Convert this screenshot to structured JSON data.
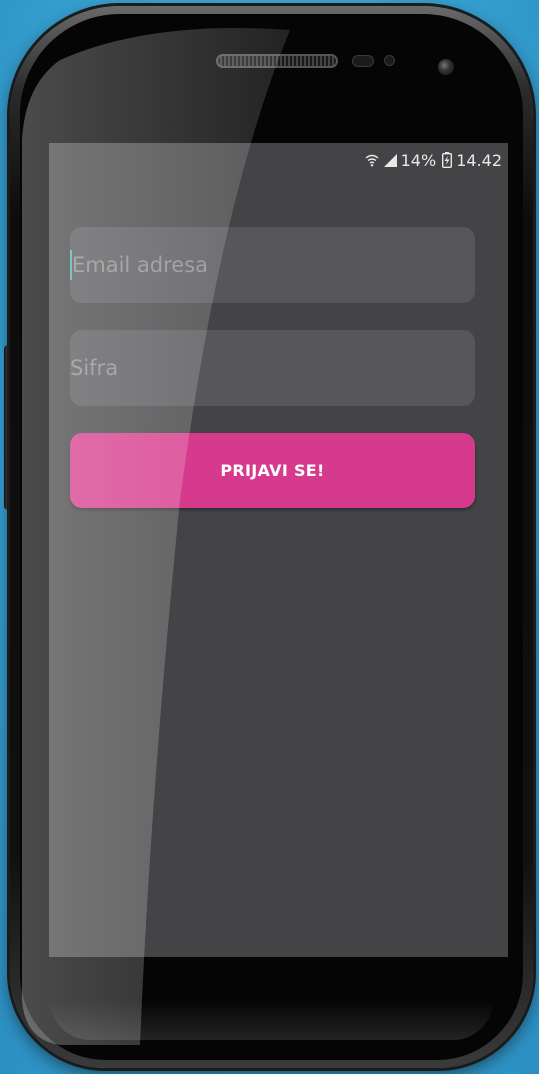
{
  "status_bar": {
    "battery_percent": "14%",
    "time": "14.42",
    "icons": [
      "wifi-icon",
      "signal-icon",
      "battery-charging-icon"
    ]
  },
  "login_form": {
    "email_placeholder": "Email adresa",
    "password_placeholder": "Sifra",
    "submit_label": "PRIJAVI SE!"
  },
  "colors": {
    "screen_background": "#444446",
    "field_background": "#57575a",
    "accent_button": "#d63a8c",
    "cursor": "#4db6ac",
    "page_background": "#3fa9d8"
  }
}
